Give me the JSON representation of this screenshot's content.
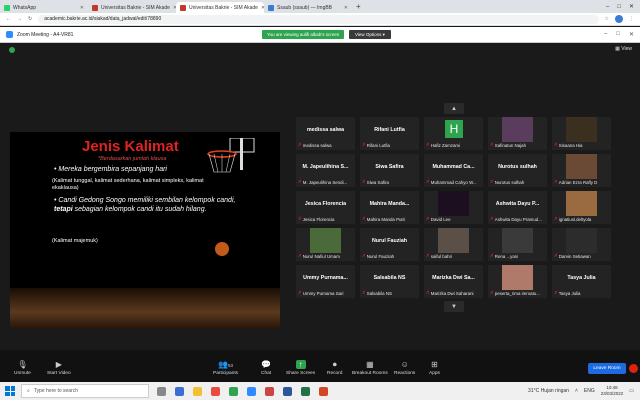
{
  "browser": {
    "tabs": [
      {
        "label": "WhatsApp",
        "color": "#25d366",
        "active": false
      },
      {
        "label": "Universitas Bakrie - SIM Akade",
        "color": "#c0392b",
        "active": false
      },
      {
        "label": "Universitas Bakrie - SIM Akade",
        "color": "#c0392b",
        "active": true
      },
      {
        "label": "Ssaub (ssaub) — ImgBB",
        "color": "#3a7bd5",
        "active": false
      }
    ],
    "url": "academic.bakrie.ac.id/siakad/data_jadwal/edit/78890"
  },
  "zoom": {
    "window_title": "Zoom Meeting - A4-VR81",
    "viewing_banner": "You are viewing aulifi albab's screen",
    "view_options": "View Options ▾",
    "view_label": "View"
  },
  "slide": {
    "title": "Jenis Kalimat",
    "subtitle": "*Berdasarkan jumlah klausa",
    "bullet1": "Mereka bergembira sepanjang hari",
    "note1": "(Kalimat tunggal, kalimat sederhana, kalimat simpleks, kalimat ekaklausa)",
    "bullet2_a": "Candi Gedong Songo memiliki sembilan kelompok candi, ",
    "bullet2_b": "tetapi",
    "bullet2_c": " sebagian kelompok candi itu sudah hilang.",
    "note2": "(Kalimat majemuk)"
  },
  "participants": [
    {
      "name": "medissa salwa",
      "label": "medissa salwa",
      "kind": "name"
    },
    {
      "name": "Rifani Lutfia",
      "label": "Rifani Lutfia",
      "kind": "name"
    },
    {
      "name": "",
      "label": "Hafiz Zamzami",
      "kind": "letter",
      "letter": "H"
    },
    {
      "name": "",
      "label": "Safinatun Najah",
      "kind": "photo",
      "photo": "#5a3d5c"
    },
    {
      "name": "",
      "label": "Sisaana Hia",
      "kind": "photo",
      "photo": "#3b3020"
    },
    {
      "name": "M. Japeulihina S...",
      "label": "M. Japeulihina Sendi...",
      "kind": "name"
    },
    {
      "name": "Siwa Safira",
      "label": "Siwa Safira",
      "kind": "name"
    },
    {
      "name": "Muhammad Ca...",
      "label": "Muhammad Cahyo W...",
      "kind": "name"
    },
    {
      "name": "Nurotus sulhah",
      "label": "Nurotus sulhah",
      "kind": "name"
    },
    {
      "name": "",
      "label": "Adrian Ezra Rafly D",
      "kind": "photo",
      "photo": "#6a4a35"
    },
    {
      "name": "Jesica Florencia",
      "label": "Jesica Florencia",
      "kind": "name"
    },
    {
      "name": "Mahira Manda...",
      "label": "Mahira Manda Putri",
      "kind": "name"
    },
    {
      "name": "",
      "label": "David Lee",
      "kind": "photo",
      "photo": "#1c1020"
    },
    {
      "name": "Ashwita Dayu P...",
      "label": "Ashwita Dayu Pramud...",
      "kind": "name"
    },
    {
      "name": "",
      "label": "ignatiusl.deltyola",
      "kind": "photo",
      "photo": "#9a6a40"
    },
    {
      "name": "",
      "label": "Nurul Nafiul Umam",
      "kind": "photo",
      "photo": "#4a6a3a"
    },
    {
      "name": "Nurul Fauziah",
      "label": "Nurul Fauziah",
      "kind": "name"
    },
    {
      "name": "",
      "label": "saiful bahri",
      "kind": "photo",
      "photo": "#5a5048"
    },
    {
      "name": "",
      "label": "Rena ...yani",
      "kind": "photo",
      "photo": "#3a3a3a"
    },
    {
      "name": "",
      "label": "Darvin Setiawan",
      "kind": "photo",
      "photo": "#2c2c2c"
    },
    {
      "name": "Ummy Purnama...",
      "label": "Ummy Purnama Sari",
      "kind": "name"
    },
    {
      "name": "Salsabila NS",
      "label": "Salsabila NS",
      "kind": "name"
    },
    {
      "name": "Marizka Dwi Sa...",
      "label": "Marizka Dwi Saharani",
      "kind": "name"
    },
    {
      "name": "",
      "label": "peserta_rima imroatu...",
      "kind": "photo",
      "photo": "#b07a6a"
    },
    {
      "name": "Tasya Julia",
      "label": "Tasya Julia",
      "kind": "name"
    }
  ],
  "toolbar": {
    "unmute": "Unmute",
    "start_video": "Start Video",
    "participants": "Participants",
    "participants_count": "53",
    "chat": "Chat",
    "share_screen": "Share Screen",
    "record": "Record",
    "breakout": "Breakout Rooms",
    "reactions": "Reactions",
    "apps": "Apps",
    "leave": "Leave Room"
  },
  "taskbar": {
    "search_placeholder": "Type here to search",
    "weather": "31°C  Hujan ringan",
    "lang": "ENG",
    "time": "10:48",
    "date": "23/03/2022"
  }
}
